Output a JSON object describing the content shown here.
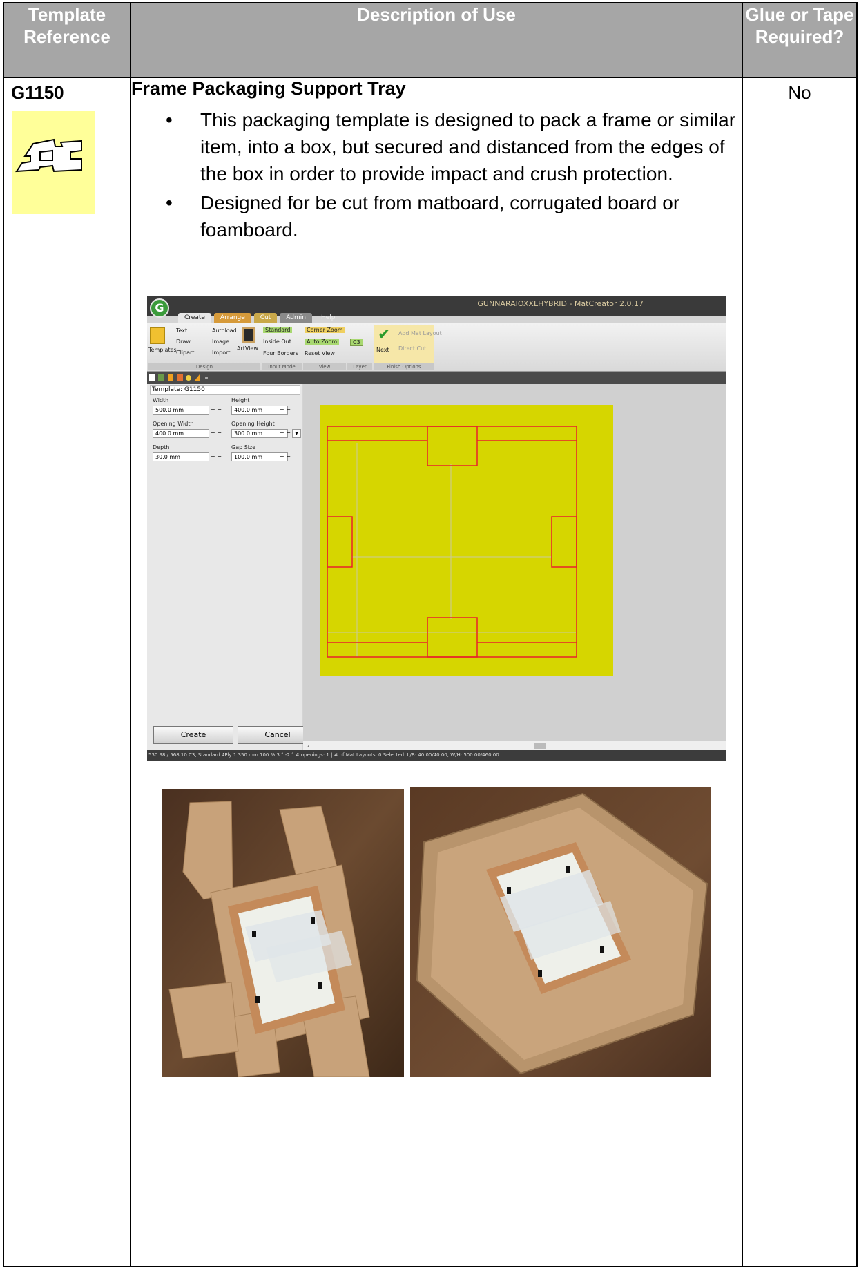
{
  "table": {
    "headers": {
      "template_reference": "Template Reference",
      "description_of_use": "Description of Use",
      "glue_or_tape": "Glue or Tape Required?"
    },
    "row": {
      "reference": "G1150",
      "title": "Frame Packaging Support Tray",
      "bullets": [
        "This packaging template is designed to pack a frame or similar item, into a box, but secured and distanced from the edges of the box in order to provide impact and crush protection.",
        "Designed for be cut from matboard, corrugated board or foamboard."
      ],
      "glue_required": "No"
    }
  },
  "app_screenshot": {
    "window_title": "GUNNARAIOXXLHYBRID - MatCreator 2.0.17",
    "logo_letter": "G",
    "tabs": [
      "Create",
      "Arrange",
      "Cut",
      "Admin",
      "Help"
    ],
    "ribbon": {
      "templates": "Templates",
      "text": "Text",
      "autoload": "Autoload",
      "draw": "Draw",
      "image": "Image",
      "clipart": "Clipart",
      "import": "Import",
      "artview": "ArtView",
      "design_group": "Design",
      "standard": "Standard",
      "inside_out": "Inside Out",
      "four_borders": "Four Borders",
      "input_mode_group": "Input Mode",
      "corner_zoom": "Corner Zoom",
      "auto_zoom": "Auto Zoom",
      "reset_view": "Reset View",
      "view_group": "View",
      "layer_value": "C3",
      "layer_group": "Layer",
      "next": "Next",
      "add_mat_layout": "Add Mat Layout",
      "direct_cut": "Direct Cut",
      "finish_group": "Finish Options"
    },
    "panel": {
      "template_title": "Template: G1150",
      "width_label": "Width",
      "width_value": "500.0 mm",
      "height_label": "Height",
      "height_value": "400.0 mm",
      "opening_width_label": "Opening Width",
      "opening_width_value": "400.0 mm",
      "opening_height_label": "Opening Height",
      "opening_height_value": "300.0 mm",
      "depth_label": "Depth",
      "depth_value": "30.0 mm",
      "gap_label": "Gap Size",
      "gap_value": "100.0 mm",
      "plus_minus": "+ −",
      "create_button": "Create",
      "cancel_button": "Cancel"
    },
    "status_bar": "530.98 / 568.10   C3, Standard 4Ply   1.350 mm   100 %   3 °   -2 °   # openings: 1 | # of Mat Layouts: 0   Selected: L/B: 40.00/40.00, W/H: 500.00/460.00",
    "colors": {
      "board": "#d6d600",
      "cut_lines": "#e8202a",
      "guide_lines": "#c9c9a0"
    }
  }
}
